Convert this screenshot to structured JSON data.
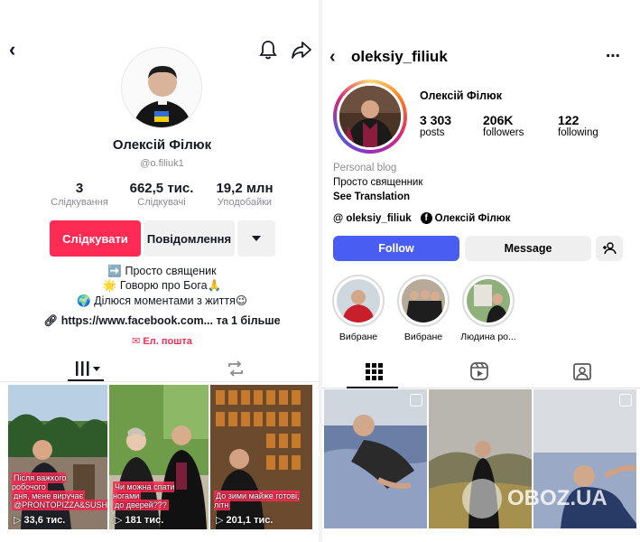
{
  "tiktok": {
    "name": "Олексій Філюк",
    "handle": "@o.filiuk1",
    "stats": [
      {
        "value": "3",
        "label": "Слідкування"
      },
      {
        "value": "662,5 тис.",
        "label": "Слідкувачі"
      },
      {
        "value": "19,2 млн",
        "label": "Уподобайки"
      }
    ],
    "follow_label": "Слідкувати",
    "message_label": "Повідомлення",
    "bio": [
      "➡️ Просто священик",
      "🌟 Говорю про Бога🙏",
      "🌍 Ділюся моментами з життя😉"
    ],
    "link": "https://www.facebook.com... та 1 більше",
    "email": "Ел. пошта",
    "videos": [
      {
        "caption_top": "Після важкого робочого",
        "caption_bottom": "дня, мене виручає",
        "caption_tag": "@PRONTOPIZZA&SUSHI.v",
        "views": "33,6 тис."
      },
      {
        "caption_top": "Чи можна спати ногами",
        "caption_bottom": "до дверей???",
        "caption_tag": "",
        "views": "181 тис."
      },
      {
        "caption_top": "До зими майже готові, літн",
        "caption_bottom": "",
        "caption_tag": "",
        "views": "201,1 тис."
      }
    ]
  },
  "instagram": {
    "username": "oleksiy_filiuk",
    "name": "Олексій Філюк",
    "stats": [
      {
        "value": "3 303",
        "label": "posts"
      },
      {
        "value": "206K",
        "label": "followers"
      },
      {
        "value": "122",
        "label": "following"
      }
    ],
    "category": "Personal blog",
    "bio": "Просто священник",
    "see_translation": "See Translation",
    "threads_handle": "oleksiy_filiuk",
    "facebook_name": "Олексій Філюк",
    "follow_label": "Follow",
    "message_label": "Message",
    "highlights": [
      "Вибране",
      "Вибране",
      "Людина ро..."
    ]
  },
  "watermark": "OBOZ.UA",
  "colors": {
    "tiktok_red": "#fe2c55",
    "ig_blue": "#4a5df2"
  }
}
